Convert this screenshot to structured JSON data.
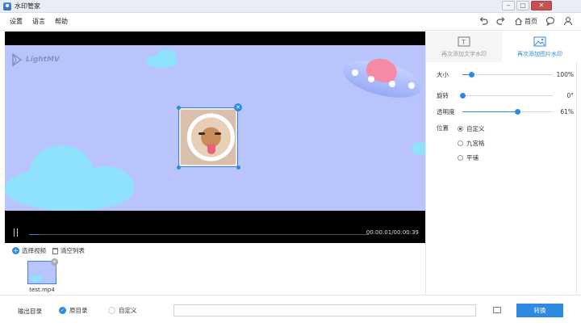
{
  "window": {
    "title": "水印管家",
    "minimize": "‒",
    "restore": "▢",
    "close": "✕"
  },
  "menu": {
    "settings": "设置",
    "language": "语言",
    "help": "帮助"
  },
  "toolbar": {
    "home_label": "首页"
  },
  "video": {
    "logo_text": "LightMV",
    "timecode": "00:00:01/00:00:39",
    "progress_fraction": 0.03
  },
  "tabs": [
    {
      "label": "再次添加文字水印",
      "icon": "text-watermark-icon",
      "active": false
    },
    {
      "label": "再次添加图片水印",
      "icon": "image-watermark-icon",
      "active": true
    }
  ],
  "properties": {
    "size": {
      "label": "大小",
      "value": "100%",
      "fraction": 0.1
    },
    "rotate": {
      "label": "旋转",
      "value": "0°",
      "fraction": 0.0
    },
    "opacity": {
      "label": "透明度",
      "value": "61%",
      "fraction": 0.61
    },
    "position": {
      "label": "位置",
      "options": [
        "自定义",
        "九宫格",
        "平铺"
      ],
      "selected": 0
    }
  },
  "files": {
    "select_video": "选择视频",
    "clear_list": "清空列表",
    "items": [
      {
        "name": "test.mp4"
      }
    ]
  },
  "output": {
    "label": "输出目录",
    "option_original": "原目录",
    "option_custom": "自定义",
    "path": "",
    "convert_label": "转换"
  },
  "colors": {
    "accent": "#2d8ae0",
    "scene_bg": "#b8c4fb",
    "cloud": "#8fe2fb"
  }
}
